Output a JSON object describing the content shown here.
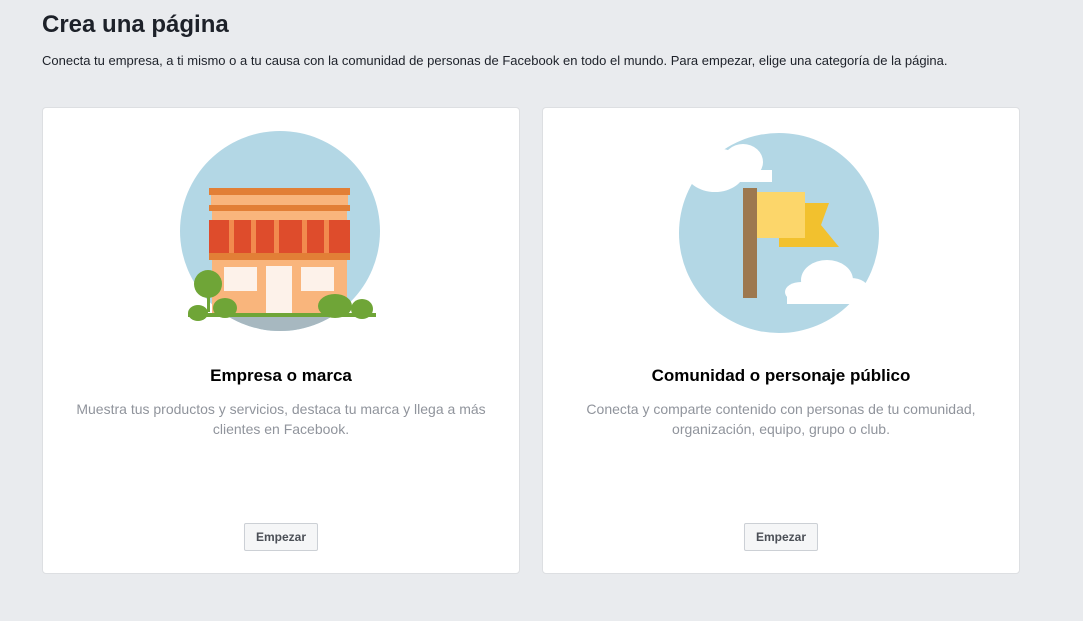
{
  "header": {
    "title": "Crea una página",
    "subtitle": "Conecta tu empresa, a ti mismo o a tu causa con la comunidad de personas de Facebook en todo el mundo. Para empezar, elige una categoría de la página."
  },
  "cards": [
    {
      "title": "Empresa o marca",
      "description": "Muestra tus productos y servicios, destaca tu marca y llega a más clientes en Facebook.",
      "button_label": "Empezar",
      "illustration_icon": "storefront-icon"
    },
    {
      "title": "Comunidad o personaje público",
      "description": "Conecta y comparte contenido con personas de tu comunidad, organización, equipo, grupo o club.",
      "button_label": "Empezar",
      "illustration_icon": "flag-icon"
    }
  ],
  "colors": {
    "background": "#e9ebee",
    "card": "#ffffff",
    "sky": "#b3d7e5",
    "awning": "#de4c2c",
    "storefront": "#f9b57c",
    "roof": "#e27f36",
    "tree": "#6fa537",
    "flag": "#fcd66a",
    "flag_back": "#f2c12e",
    "pole": "#9d784f"
  }
}
